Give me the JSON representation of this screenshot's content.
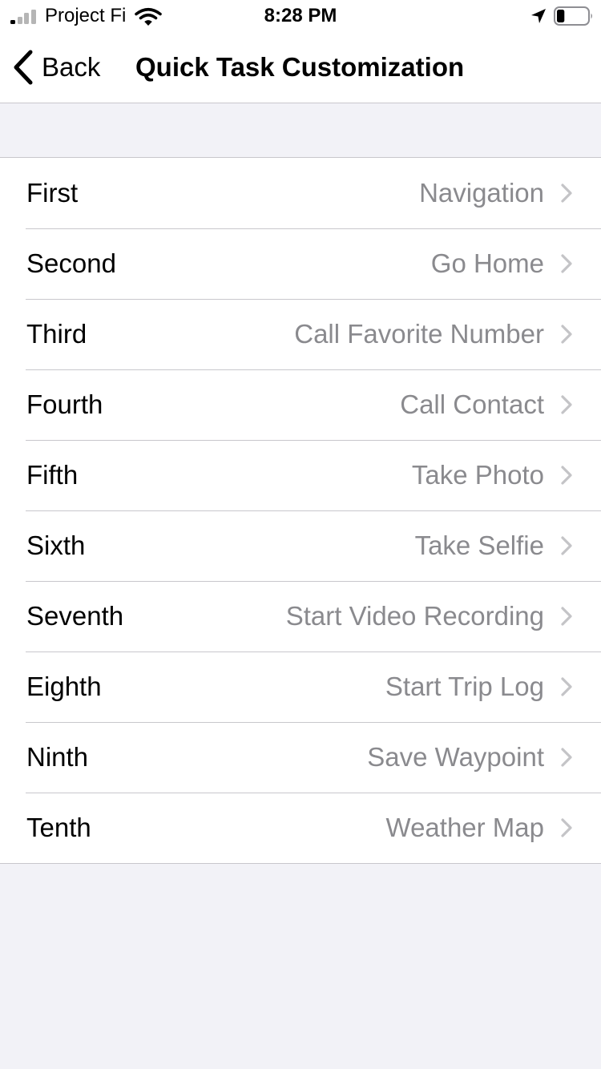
{
  "status_bar": {
    "carrier": "Project Fi",
    "time": "8:28 PM",
    "icons": [
      "signal-icon",
      "wifi-icon",
      "location-arrow-icon",
      "battery-icon"
    ],
    "signal_bars": 4,
    "signal_active_bars": 1,
    "battery_level": 0.25
  },
  "nav": {
    "back_label": "Back",
    "title": "Quick Task Customization"
  },
  "tasks": [
    {
      "slot": "First",
      "value": "Navigation"
    },
    {
      "slot": "Second",
      "value": "Go Home"
    },
    {
      "slot": "Third",
      "value": "Call Favorite Number"
    },
    {
      "slot": "Fourth",
      "value": "Call Contact"
    },
    {
      "slot": "Fifth",
      "value": "Take Photo"
    },
    {
      "slot": "Sixth",
      "value": "Take Selfie"
    },
    {
      "slot": "Seventh",
      "value": "Start Video Recording"
    },
    {
      "slot": "Eighth",
      "value": "Start Trip Log"
    },
    {
      "slot": "Ninth",
      "value": "Save Waypoint"
    },
    {
      "slot": "Tenth",
      "value": "Weather Map"
    }
  ],
  "colors": {
    "background": "#f2f2f7",
    "cell_background": "#ffffff",
    "separator": "#c8c7cc",
    "secondary_text": "#8a8a8e",
    "chevron": "#c4c4c7",
    "signal_active": "#000000",
    "signal_inactive": "#b5b5b5"
  }
}
